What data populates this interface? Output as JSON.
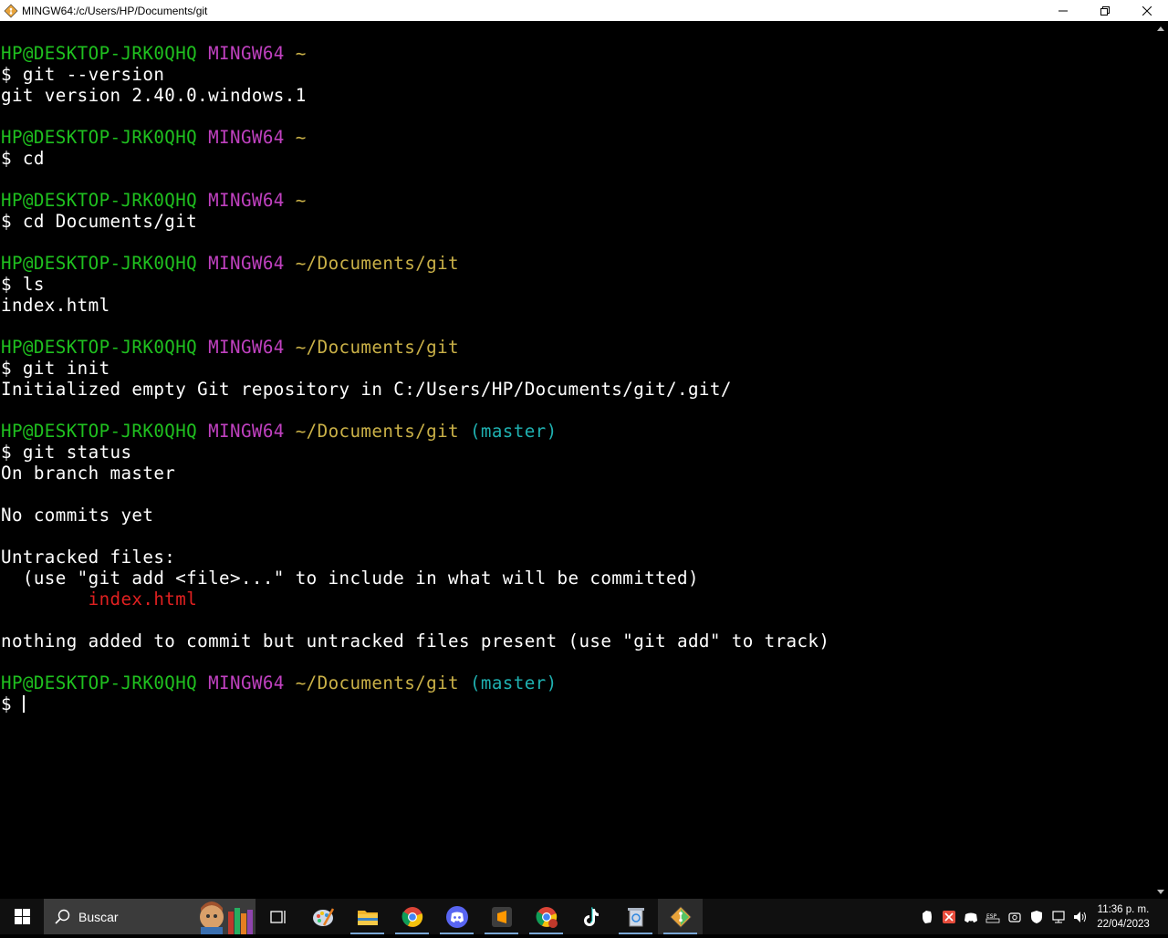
{
  "window": {
    "title": "MINGW64:/c/Users/HP/Documents/git"
  },
  "terminal": {
    "lines": [
      [
        {
          "t": "HP@DESKTOP-JRK0QHQ",
          "c": "green"
        },
        {
          "t": " "
        },
        {
          "t": "MINGW64",
          "c": "magenta"
        },
        {
          "t": " "
        },
        {
          "t": "~",
          "c": "yellow"
        }
      ],
      [
        {
          "t": "$ git --version"
        }
      ],
      [
        {
          "t": "git version 2.40.0.windows.1"
        }
      ],
      [],
      [
        {
          "t": "HP@DESKTOP-JRK0QHQ",
          "c": "green"
        },
        {
          "t": " "
        },
        {
          "t": "MINGW64",
          "c": "magenta"
        },
        {
          "t": " "
        },
        {
          "t": "~",
          "c": "yellow"
        }
      ],
      [
        {
          "t": "$ cd"
        }
      ],
      [],
      [
        {
          "t": "HP@DESKTOP-JRK0QHQ",
          "c": "green"
        },
        {
          "t": " "
        },
        {
          "t": "MINGW64",
          "c": "magenta"
        },
        {
          "t": " "
        },
        {
          "t": "~",
          "c": "yellow"
        }
      ],
      [
        {
          "t": "$ cd Documents/git"
        }
      ],
      [],
      [
        {
          "t": "HP@DESKTOP-JRK0QHQ",
          "c": "green"
        },
        {
          "t": " "
        },
        {
          "t": "MINGW64",
          "c": "magenta"
        },
        {
          "t": " "
        },
        {
          "t": "~/Documents/git",
          "c": "yellow"
        }
      ],
      [
        {
          "t": "$ ls"
        }
      ],
      [
        {
          "t": "index.html"
        }
      ],
      [],
      [
        {
          "t": "HP@DESKTOP-JRK0QHQ",
          "c": "green"
        },
        {
          "t": " "
        },
        {
          "t": "MINGW64",
          "c": "magenta"
        },
        {
          "t": " "
        },
        {
          "t": "~/Documents/git",
          "c": "yellow"
        }
      ],
      [
        {
          "t": "$ git init"
        }
      ],
      [
        {
          "t": "Initialized empty Git repository in C:/Users/HP/Documents/git/.git/"
        }
      ],
      [],
      [
        {
          "t": "HP@DESKTOP-JRK0QHQ",
          "c": "green"
        },
        {
          "t": " "
        },
        {
          "t": "MINGW64",
          "c": "magenta"
        },
        {
          "t": " "
        },
        {
          "t": "~/Documents/git",
          "c": "yellow"
        },
        {
          "t": " "
        },
        {
          "t": "(master)",
          "c": "cyan"
        }
      ],
      [
        {
          "t": "$ git status"
        }
      ],
      [
        {
          "t": "On branch master"
        }
      ],
      [],
      [
        {
          "t": "No commits yet"
        }
      ],
      [],
      [
        {
          "t": "Untracked files:"
        }
      ],
      [
        {
          "t": "  (use \"git add <file>...\" to include in what will be committed)"
        }
      ],
      [
        {
          "t": "        "
        },
        {
          "t": "index.html",
          "c": "red"
        }
      ],
      [],
      [
        {
          "t": "nothing added to commit but untracked files present (use \"git add\" to track)"
        }
      ],
      [],
      [
        {
          "t": "HP@DESKTOP-JRK0QHQ",
          "c": "green"
        },
        {
          "t": " "
        },
        {
          "t": "MINGW64",
          "c": "magenta"
        },
        {
          "t": " "
        },
        {
          "t": "~/Documents/git",
          "c": "yellow"
        },
        {
          "t": " "
        },
        {
          "t": "(master)",
          "c": "cyan"
        }
      ],
      [
        {
          "t": "$ "
        }
      ]
    ]
  },
  "taskbar": {
    "search_label": "Buscar",
    "apps": [
      {
        "icon": "task-view-icon"
      },
      {
        "icon": "paint-icon"
      },
      {
        "icon": "file-explorer-icon"
      },
      {
        "icon": "chrome-icon"
      },
      {
        "icon": "discord-icon"
      },
      {
        "icon": "sublime-text-icon"
      },
      {
        "icon": "chrome-profile-icon"
      },
      {
        "icon": "tiktok-icon"
      },
      {
        "icon": "recycle-app-icon"
      },
      {
        "icon": "git-bash-icon"
      }
    ],
    "clock_time": "11:36 p. m.",
    "clock_date": "22/04/2023"
  },
  "colors": {
    "green": "#1fc01f",
    "magenta": "#c041c0",
    "yellow": "#c9b047",
    "cyan": "#1fb0b0",
    "red": "#e02020"
  }
}
